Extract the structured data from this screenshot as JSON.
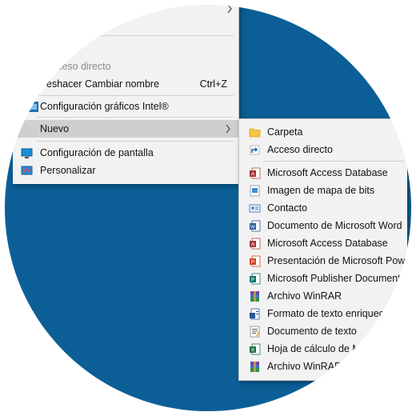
{
  "context_menu": {
    "items": [
      {
        "label": "acceso directo"
      },
      {
        "label": "eshacer Cambiar nombre",
        "shortcut": "Ctrl+Z"
      },
      {
        "label": "Configuración gráficos Intel®"
      },
      {
        "label": "Nuevo"
      },
      {
        "label": "Configuración de pantalla"
      },
      {
        "label": "Personalizar"
      }
    ]
  },
  "submenu_nuevo": {
    "items": [
      {
        "label": "Carpeta",
        "icon": "folder-icon"
      },
      {
        "label": "Acceso directo",
        "icon": "shortcut-icon"
      },
      {
        "label": "Microsoft Access Database",
        "icon": "access-icon"
      },
      {
        "label": "Imagen de mapa de bits",
        "icon": "bitmap-icon"
      },
      {
        "label": "Contacto",
        "icon": "contact-icon"
      },
      {
        "label": "Documento de Microsoft Word",
        "icon": "word-icon"
      },
      {
        "label": "Microsoft Access Database",
        "icon": "access-icon"
      },
      {
        "label": "Presentación de Microsoft Powe",
        "icon": "powerpoint-icon"
      },
      {
        "label": "Microsoft Publisher Document",
        "icon": "publisher-icon"
      },
      {
        "label": "Archivo WinRAR",
        "icon": "winrar-icon"
      },
      {
        "label": "Formato de texto enriqueci",
        "icon": "rtf-icon"
      },
      {
        "label": "Documento de texto",
        "icon": "text-file-icon"
      },
      {
        "label": "Hoja de cálculo de M",
        "icon": "excel-icon"
      },
      {
        "label": "Archivo WinRAR",
        "icon": "winrar-icon"
      }
    ]
  },
  "colors": {
    "desktop": "#0b5f96",
    "menu_bg": "#f2f2f2",
    "highlight": "#cfcfcf"
  }
}
